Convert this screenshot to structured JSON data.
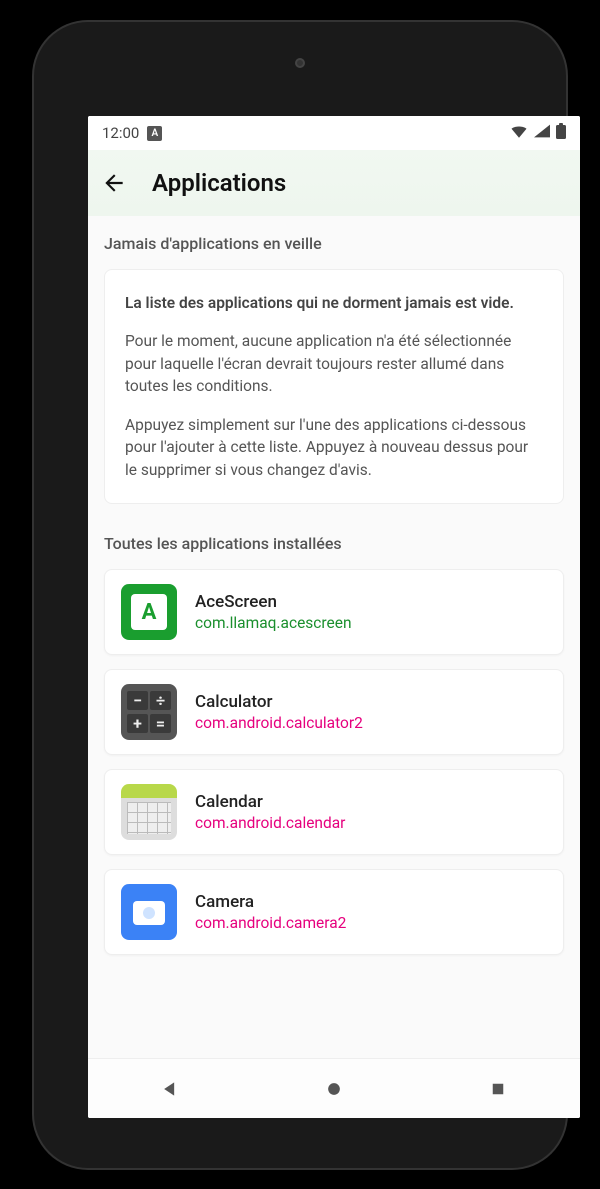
{
  "statusbar": {
    "time": "12:00"
  },
  "appbar": {
    "title": "Applications"
  },
  "sections": {
    "never_sleep_title": "Jamais d'applications en veille",
    "installed_title": "Toutes les applications installées"
  },
  "info": {
    "heading": "La liste des applications qui ne dorment jamais est vide.",
    "p1": "Pour le moment, aucune application n'a été sélectionnée pour laquelle l'écran devrait toujours rester allumé dans toutes les conditions.",
    "p2": "Appuyez simplement sur l'une des applications ci-dessous pour l'ajouter à cette liste. Appuyez à nouveau dessus pour le supprimer si vous changez d'avis."
  },
  "apps": [
    {
      "name": "AceScreen",
      "package": "com.llamaq.acescreen",
      "pkg_color": "green",
      "icon": "ace"
    },
    {
      "name": "Calculator",
      "package": "com.android.calculator2",
      "pkg_color": "pink",
      "icon": "calc"
    },
    {
      "name": "Calendar",
      "package": "com.android.calendar",
      "pkg_color": "pink",
      "icon": "cal"
    },
    {
      "name": "Camera",
      "package": "com.android.camera2",
      "pkg_color": "pink",
      "icon": "cam"
    }
  ]
}
